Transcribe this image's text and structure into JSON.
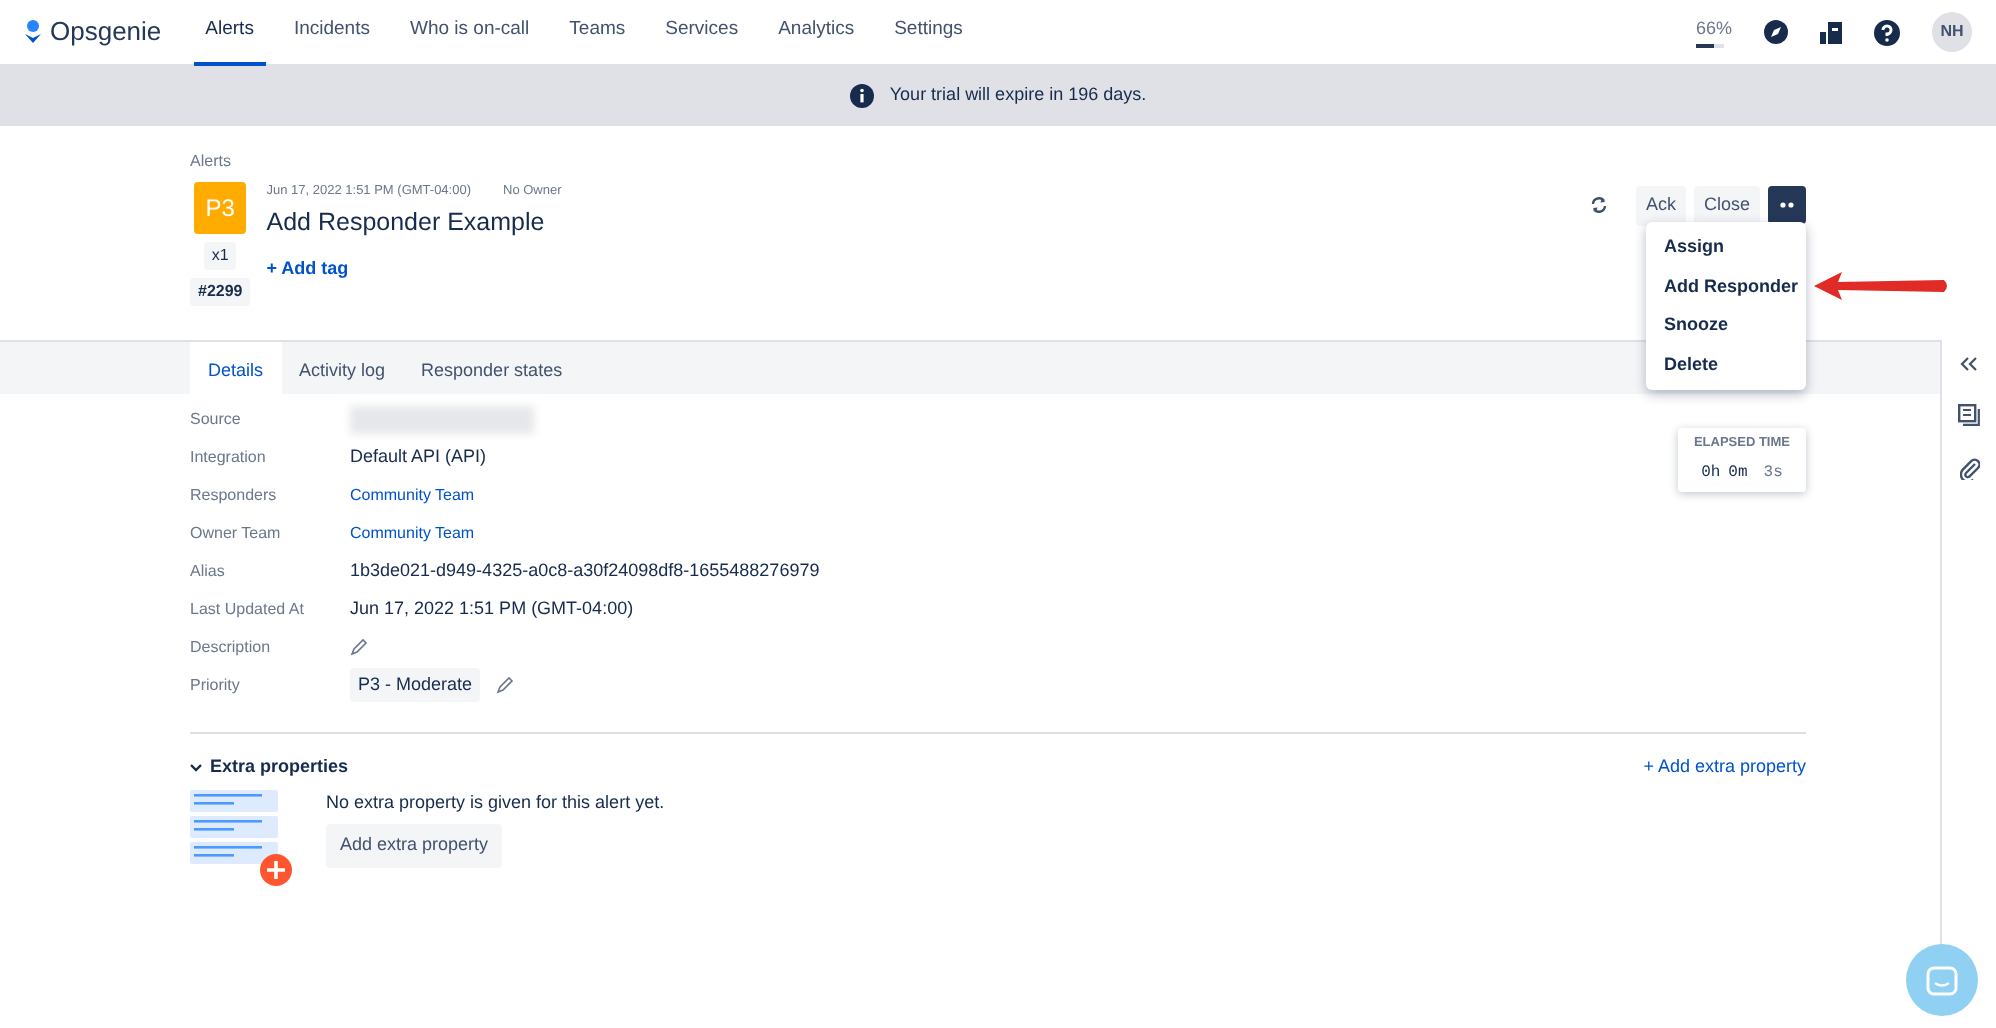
{
  "nav": {
    "logo": "Opsgenie",
    "items": [
      {
        "label": "Alerts",
        "selected": true
      },
      {
        "label": "Incidents",
        "selected": false
      },
      {
        "label": "Who is on-call",
        "selected": false
      },
      {
        "label": "Teams",
        "selected": false
      },
      {
        "label": "Services",
        "selected": false
      },
      {
        "label": "Analytics",
        "selected": false
      },
      {
        "label": "Settings",
        "selected": false
      }
    ],
    "usage": {
      "text": "66%",
      "level": 0.66
    },
    "avatar": "NH"
  },
  "banner": {
    "text": "Your trial will expire in 196 days."
  },
  "alert": {
    "breadcrumb": "Alerts",
    "priority": "P3",
    "count": "x1",
    "number": "#2299",
    "created": "Jun 17, 2022 1:51 PM (GMT-04:00)",
    "owner": "No Owner",
    "title": "Add Responder Example",
    "add_tag": "+ Add tag",
    "actions": [
      "Ack",
      "Close"
    ],
    "menu": [
      {
        "label": "Assign",
        "pointed": false
      },
      {
        "label": "Add Responder",
        "pointed": true
      },
      {
        "label": "Snooze",
        "pointed": false
      },
      {
        "label": "Delete",
        "pointed": false
      }
    ]
  },
  "tabs": [
    {
      "label": "Details",
      "selected": true
    },
    {
      "label": "Activity log",
      "selected": false
    },
    {
      "label": "Responder states",
      "selected": false
    }
  ],
  "fields": [
    {
      "label": "Source",
      "kind": "blurred"
    },
    {
      "label": "Integration",
      "kind": "text",
      "value": "Default API (API)"
    },
    {
      "label": "Responders",
      "kind": "link",
      "value": "Community Team"
    },
    {
      "label": "Owner Team",
      "kind": "link",
      "value": "Community Team"
    },
    {
      "label": "Alias",
      "kind": "text",
      "value": "1b3de021-d949-4325-a0c8-a30f24098df8-1655488276979"
    },
    {
      "label": "Last Updated At",
      "kind": "text",
      "value": "Jun 17, 2022 1:51 PM (GMT-04:00)"
    },
    {
      "label": "Description",
      "kind": "edit"
    },
    {
      "label": "Priority",
      "kind": "badge",
      "value": "P3 - Moderate"
    }
  ],
  "elapsed": {
    "label": "ELAPSED TIME",
    "hours": "0h",
    "minutes": "0m",
    "seconds": "3s"
  },
  "extra": {
    "title": "Extra properties",
    "expanded": true,
    "add_link": "+ Add extra property",
    "empty_text": "No extra property is given for this alert yet.",
    "button": "Add extra property"
  }
}
